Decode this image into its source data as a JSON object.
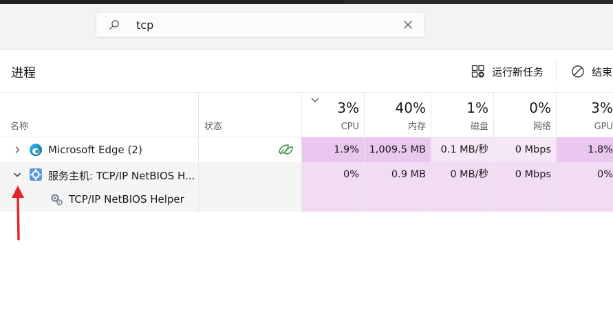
{
  "search": {
    "query": "tcp"
  },
  "page": {
    "title": "进程"
  },
  "toolbar": {
    "run_new_task": "运行新任务",
    "end_task": "结束"
  },
  "columns": {
    "name": "名称",
    "status": "状态",
    "cpu": {
      "label": "CPU",
      "percent": "3%"
    },
    "memory": {
      "label": "内存",
      "percent": "40%"
    },
    "disk": {
      "label": "磁盘",
      "percent": "1%"
    },
    "network": {
      "label": "网络",
      "percent": "0%"
    },
    "gpu": {
      "label": "GPU",
      "percent": "3%"
    }
  },
  "rows": [
    {
      "name": "Microsoft Edge (2)",
      "cpu": "1.9%",
      "memory": "1,009.5 MB",
      "disk": "0.1 MB/秒",
      "network": "0 Mbps",
      "gpu": "1.8%"
    },
    {
      "name": "服务主机: TCP/IP NetBIOS H...",
      "cpu": "0%",
      "memory": "0.9 MB",
      "disk": "0 MB/秒",
      "network": "0 Mbps",
      "gpu": "0%"
    },
    {
      "name": "TCP/IP NetBIOS Helper"
    }
  ],
  "colors": {
    "heat_strong": "#e9c7ee",
    "heat_medium": "#f1dcf3",
    "heat_light": "#f5e7f5",
    "row_selected_bg": "#f5f5f5",
    "annotation_arrow": "#e0262b"
  }
}
